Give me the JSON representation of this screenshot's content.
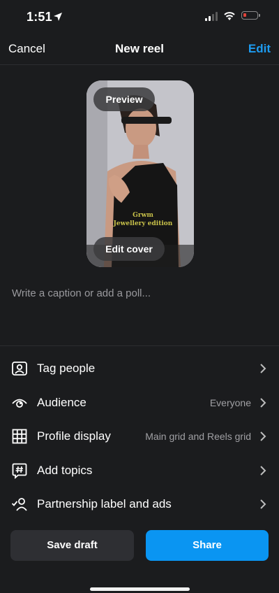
{
  "status_bar": {
    "time": "1:51"
  },
  "nav": {
    "cancel": "Cancel",
    "title": "New reel",
    "edit": "Edit"
  },
  "preview": {
    "preview_label": "Preview",
    "edit_cover_label": "Edit cover",
    "overlay_line1": "Grwm",
    "overlay_line2": "Jewellery edition"
  },
  "caption": {
    "placeholder": "Write a caption or add a poll..."
  },
  "options": [
    {
      "label": "Tag people",
      "value": "",
      "icon": "tag-person-icon"
    },
    {
      "label": "Audience",
      "value": "Everyone",
      "icon": "eye-icon"
    },
    {
      "label": "Profile display",
      "value": "Main grid and Reels grid",
      "icon": "grid-icon"
    },
    {
      "label": "Add topics",
      "value": "",
      "icon": "hashtag-icon"
    },
    {
      "label": "Partnership label and ads",
      "value": "",
      "icon": "partnership-icon"
    }
  ],
  "actions": {
    "save_draft": "Save draft",
    "share": "Share"
  },
  "colors": {
    "accent": "#1d9bf0",
    "share_button": "#0a95f2",
    "background": "#1b1c1e",
    "battery_low": "#e0433a"
  }
}
